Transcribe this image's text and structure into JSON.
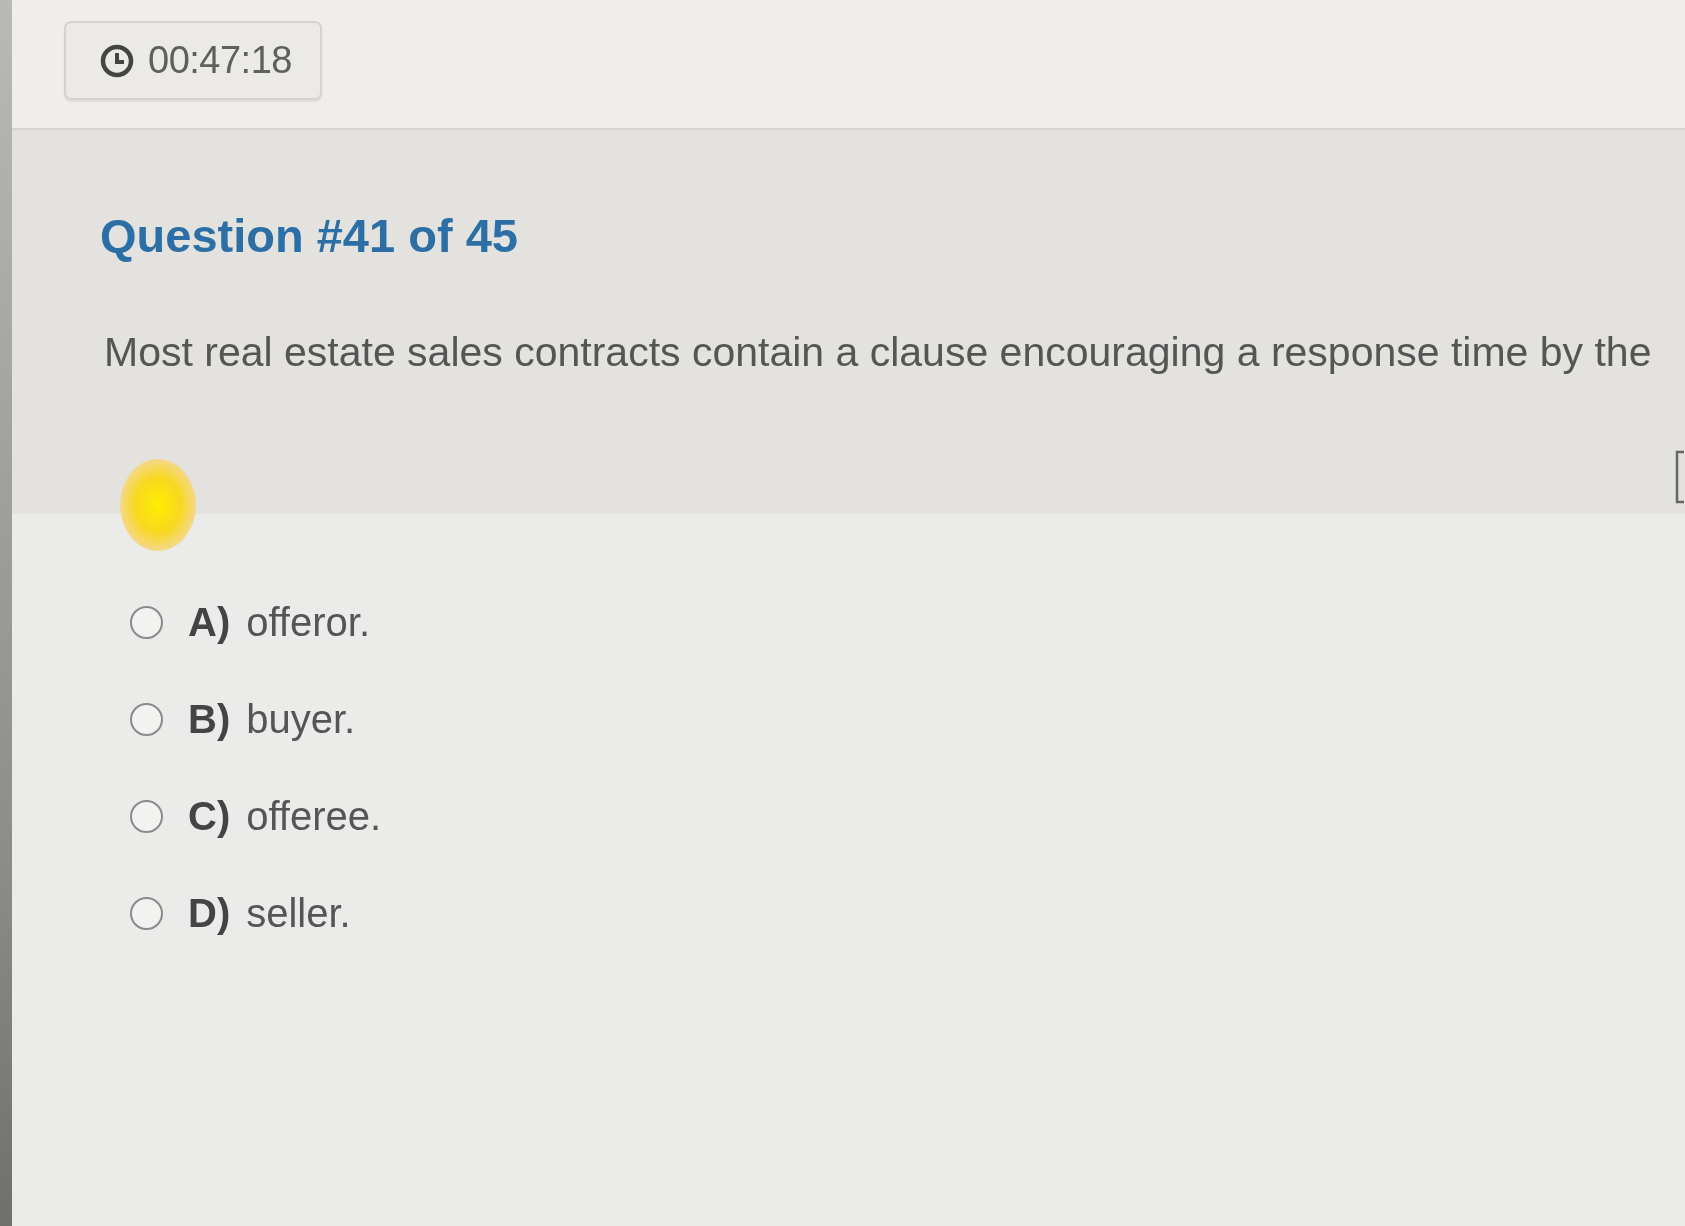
{
  "timer": {
    "time": "00:47:18"
  },
  "question": {
    "title": "Question #41 of 45",
    "text": "Most real estate sales contracts contain a clause encouraging a response time by the"
  },
  "options": [
    {
      "letter": "A)",
      "text": "offeror.",
      "selected": false
    },
    {
      "letter": "B)",
      "text": "buyer.",
      "selected": false
    },
    {
      "letter": "C)",
      "text": "offeree.",
      "selected": false
    },
    {
      "letter": "D)",
      "text": "seller.",
      "selected": false
    }
  ]
}
